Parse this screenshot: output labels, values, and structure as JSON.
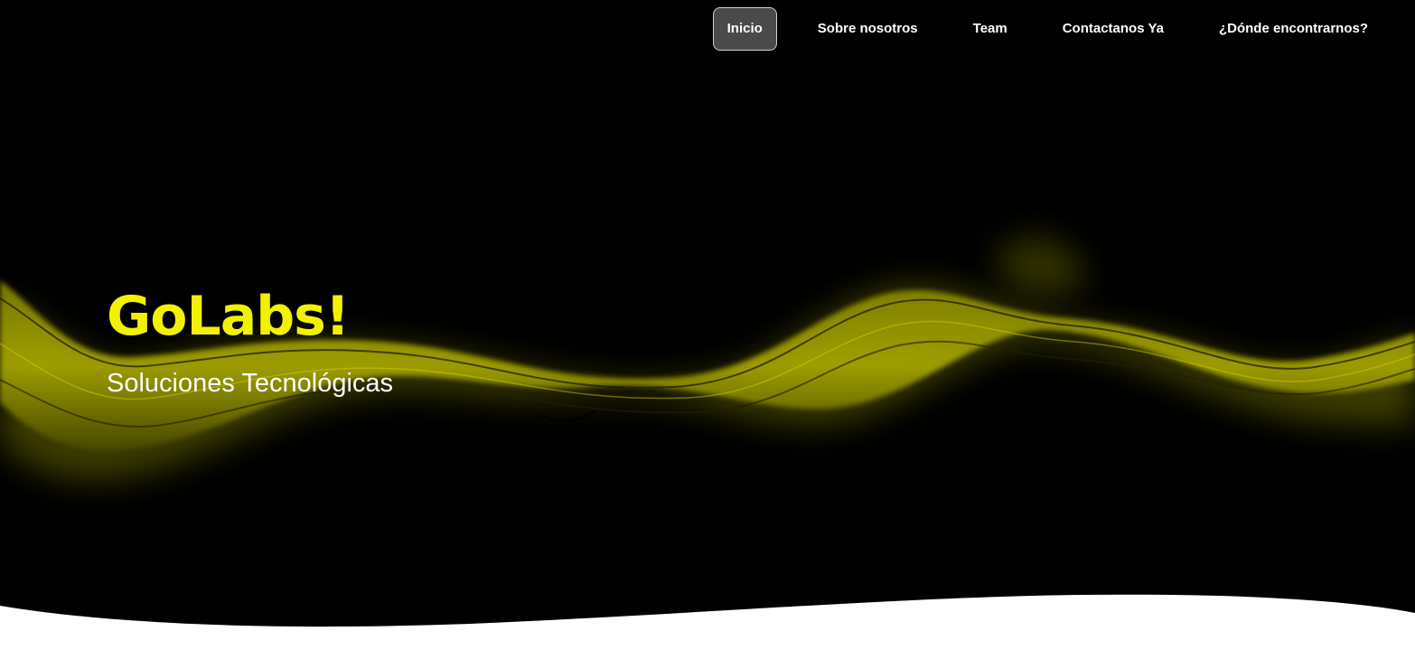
{
  "nav": {
    "items": [
      {
        "label": "Inicio",
        "active": true
      },
      {
        "label": "Sobre nosotros",
        "active": false
      },
      {
        "label": "Team",
        "active": false
      },
      {
        "label": "Contactanos Ya",
        "active": false
      },
      {
        "label": "¿Dónde encontrarnos?",
        "active": false
      }
    ]
  },
  "hero": {
    "title": "GoLabs!",
    "subtitle": "Soluciones Tecnológicas"
  },
  "colors": {
    "background": "#000000",
    "accent": "#f2f200",
    "wave": "#bfbf00",
    "text": "#ffffff",
    "active_nav_bg": "#4a4a4a"
  }
}
